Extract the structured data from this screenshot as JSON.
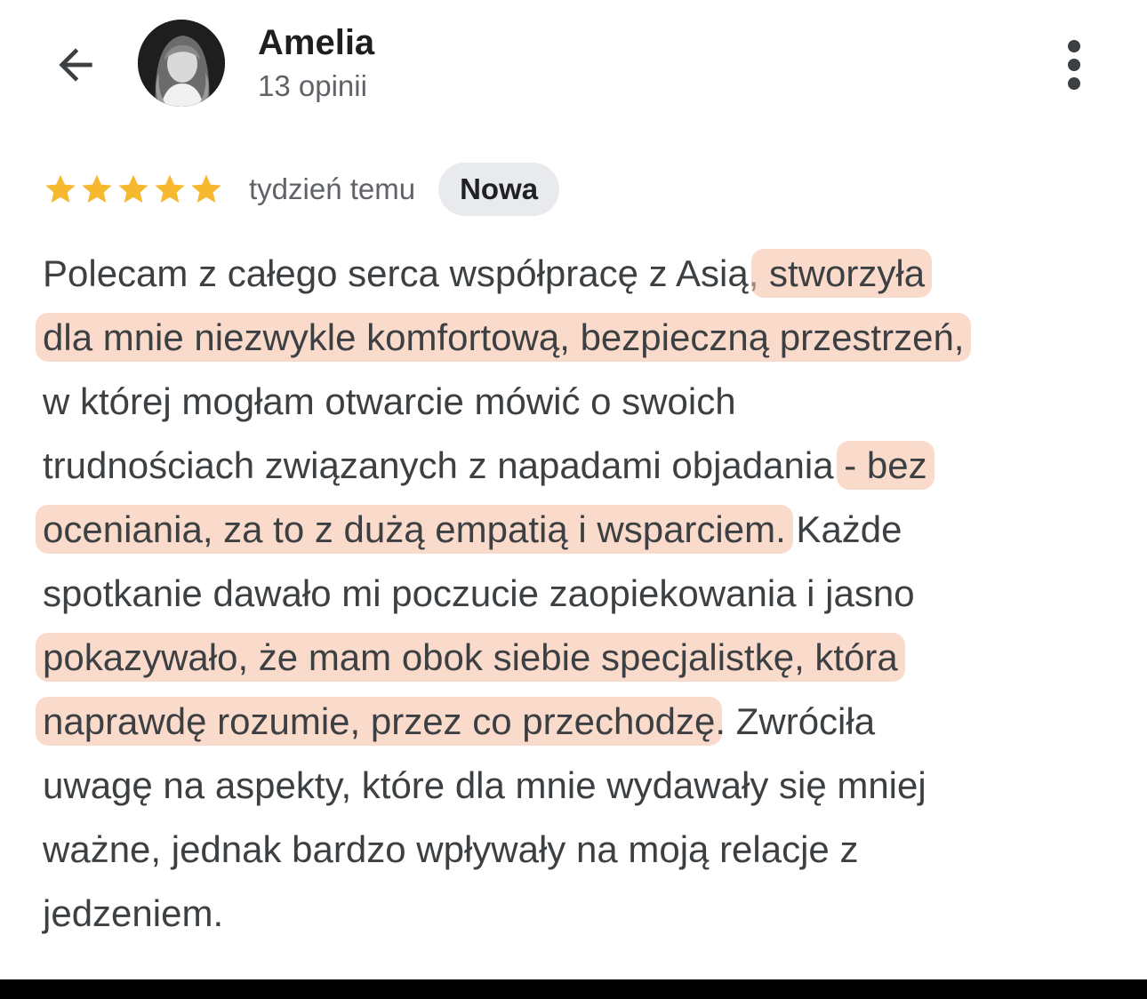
{
  "header": {
    "author_name": "Amelia",
    "review_count": "13 opinii",
    "back_icon": "arrow-left-icon",
    "more_icon": "more-vert-icon"
  },
  "review": {
    "rating": 5,
    "max_rating": 5,
    "date": "tydzień temu",
    "badge": "Nowa",
    "star_color": "#f5b82e",
    "highlight_color": "#f5bea0",
    "lines": [
      {
        "plain": "Polecam z całego serca współpracę z Asią,",
        "hl": " stworzyła",
        "after": ""
      },
      {
        "plain": "",
        "hl": "dla mnie niezwykle komfortową, bezpieczną przestrzeń,",
        "after": ""
      },
      {
        "plain": "w której mogłam otwarcie mówić o swoich",
        "hl": "",
        "after": ""
      },
      {
        "plain": "trudnościach związanych z napadami objadania ",
        "hl": "- bez",
        "after": ""
      },
      {
        "plain": "",
        "hl": "oceniania, za to z dużą empatią i wsparciem.",
        "after": " Każde"
      },
      {
        "plain": "spotkanie dawało mi poczucie zaopiekowania i jasno",
        "hl": "",
        "after": ""
      },
      {
        "plain": "",
        "hl": "pokazywało, że mam obok siebie specjalistkę, która",
        "after": ""
      },
      {
        "plain": "",
        "hl": "naprawdę rozumie, przez co przechodzę",
        "after": ". Zwróciła"
      },
      {
        "plain": "uwagę na aspekty, które dla mnie wydawały się mniej",
        "hl": "",
        "after": ""
      },
      {
        "plain": "ważne, jednak bardzo wpływały na moją relacje z",
        "hl": "",
        "after": ""
      },
      {
        "plain": "jedzeniem.",
        "hl": "",
        "after": ""
      }
    ]
  }
}
